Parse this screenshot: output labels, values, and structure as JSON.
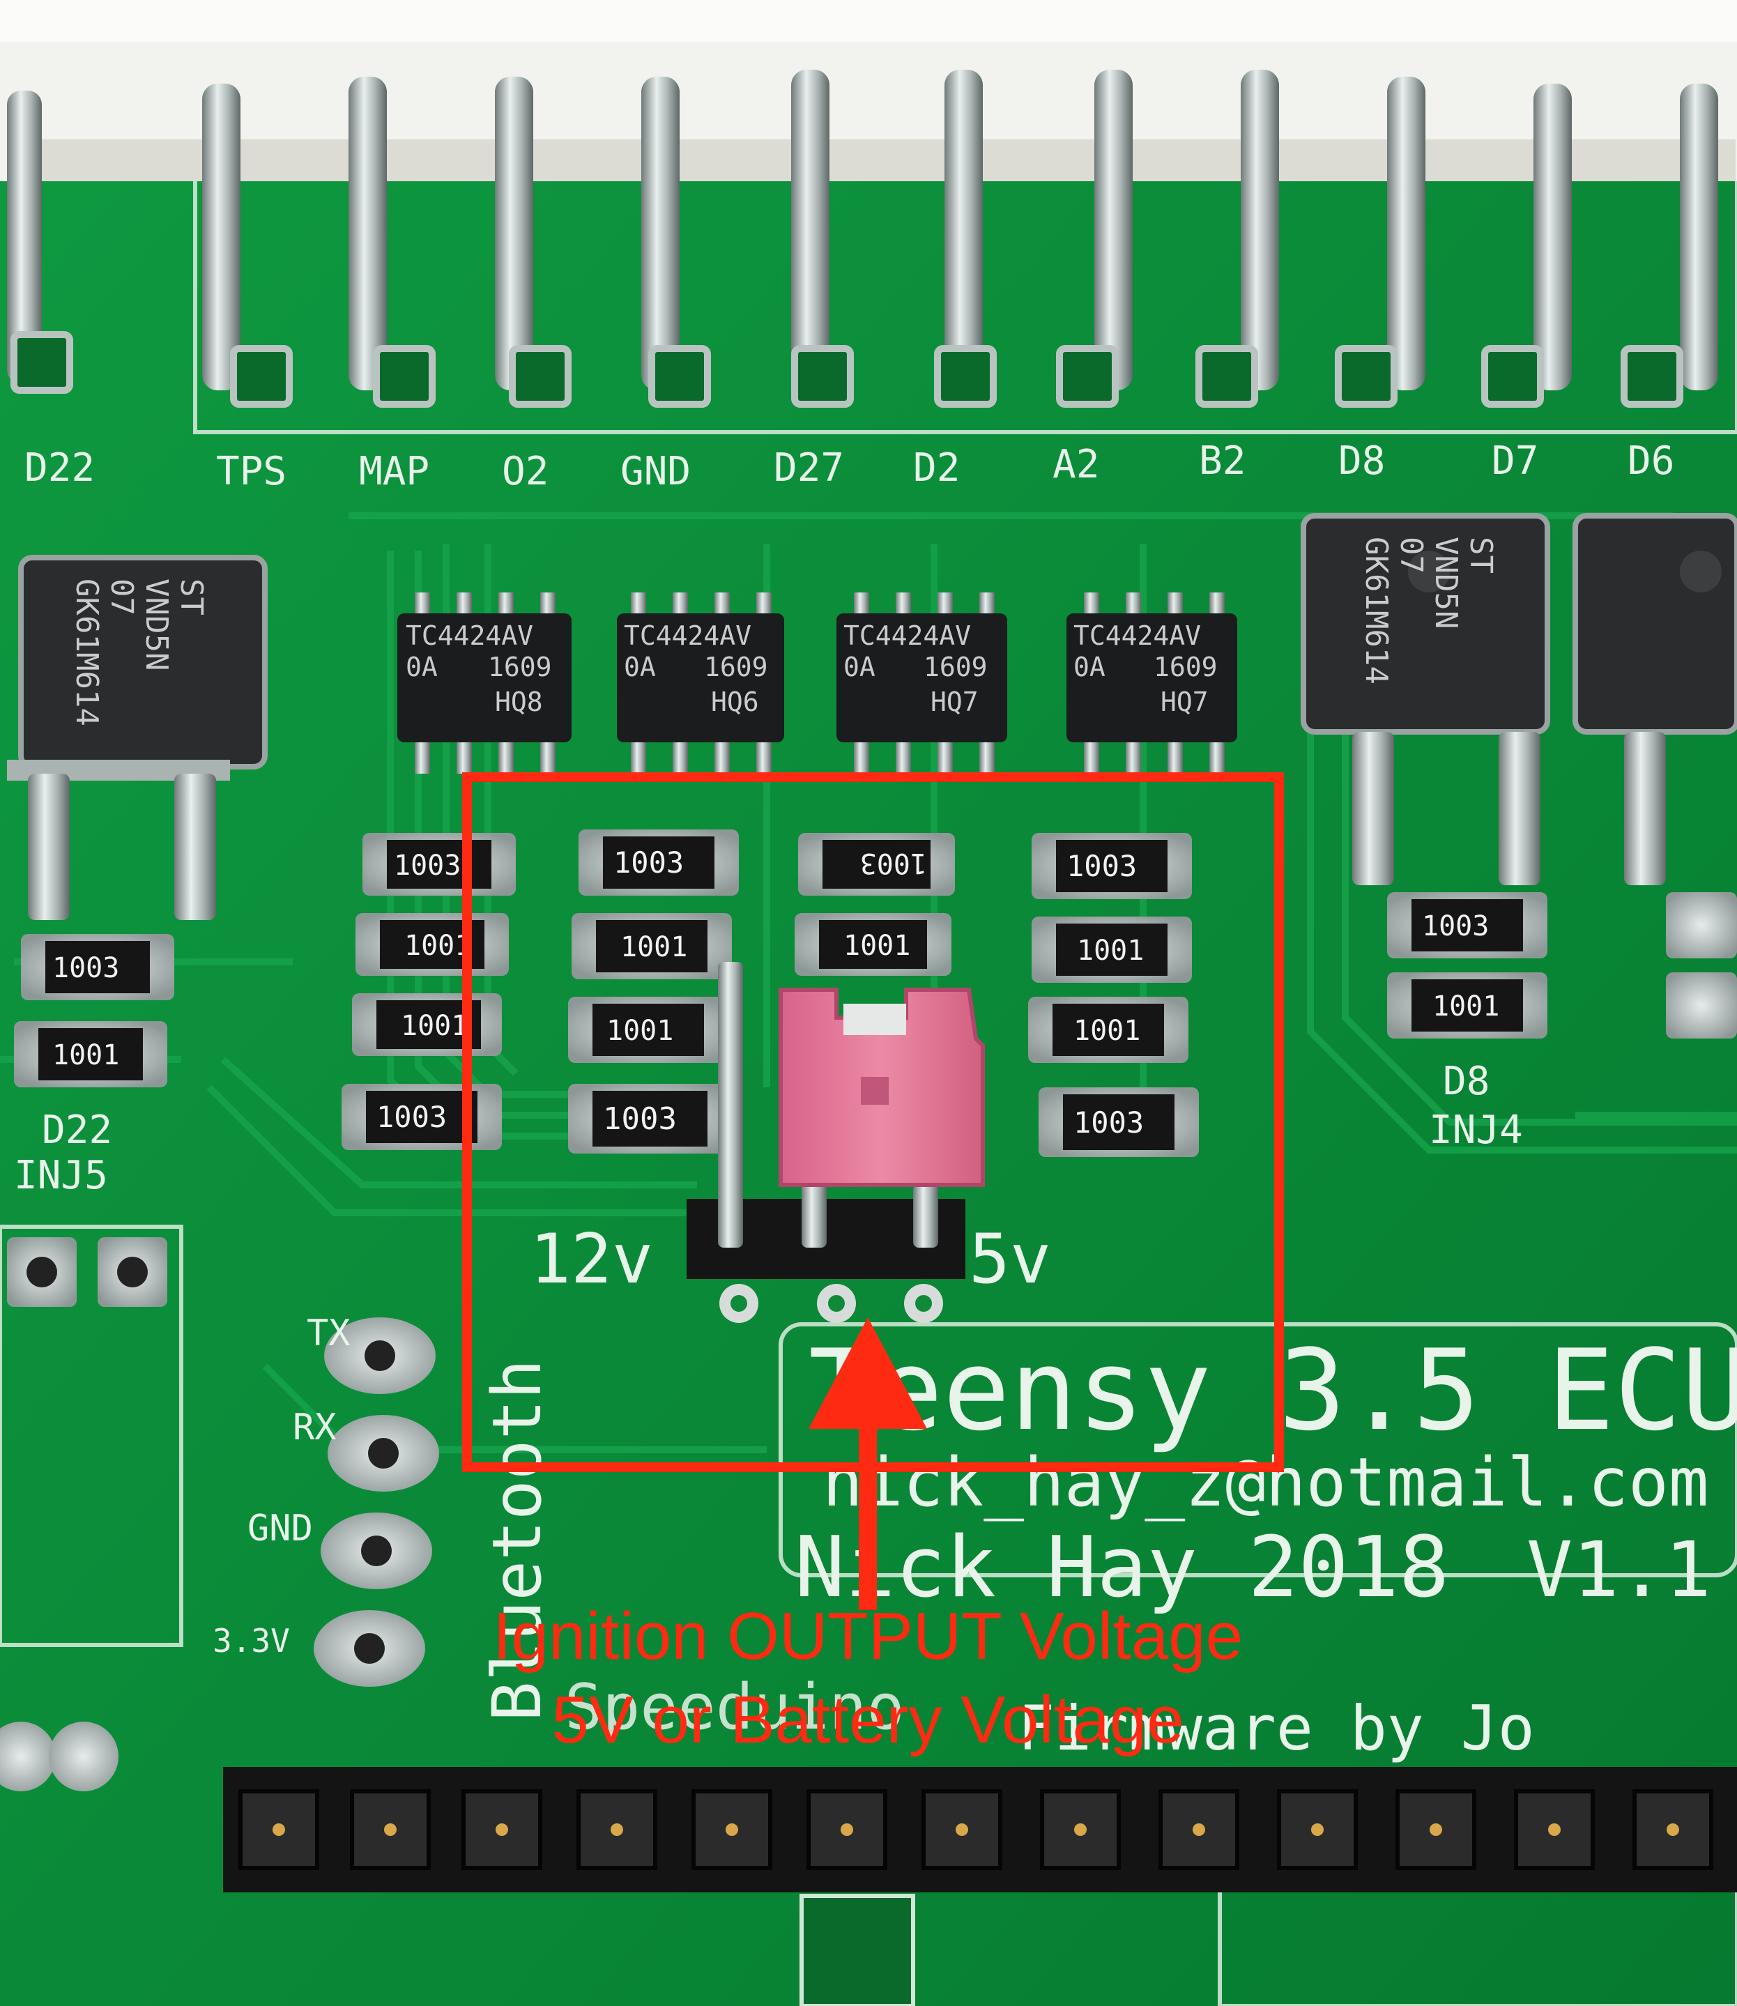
{
  "pin_labels": [
    "D22",
    "TPS",
    "MAP",
    "O2",
    "GND",
    "D27",
    "D2",
    "A2",
    "B2",
    "D8",
    "D7",
    "D6"
  ],
  "driver_chip": {
    "line1": "TC4424AV",
    "line2": "0A",
    "date": "1609",
    "batches": [
      "HQ8",
      "HQ6",
      "HQ7",
      "HQ7"
    ]
  },
  "mosfet": {
    "line1": "ST",
    "line2": "VND5N",
    "line3": "07",
    "line4": "GK61M614"
  },
  "resistors": {
    "r1": "1003",
    "r2": "1001"
  },
  "board_labels": {
    "d22": "D22",
    "inj5": "INJ5",
    "d8": "D8",
    "inj4": "INJ4",
    "v12": "12v",
    "v5": "5v",
    "tx": "TX",
    "rx": "RX",
    "gnd": "GND",
    "v33": "3.3V",
    "bluetooth": "Bluetooth",
    "title": "Teensy 3.5 ECU",
    "email": "nick_hay_z@hotmail.com",
    "author": "Nick Hay 2018",
    "version": "V1.1",
    "bottom_partial": "Speeduino",
    "firmware": "Firmware by Jo"
  },
  "annotation": {
    "line1": "Ignition OUTPUT Voltage",
    "line2": "5V or Battery Voltage",
    "color": "#ff2a12"
  },
  "colors": {
    "pcb": "#0e8a3a",
    "jumper": "#e0708f",
    "chip": "#1a1a1a"
  }
}
